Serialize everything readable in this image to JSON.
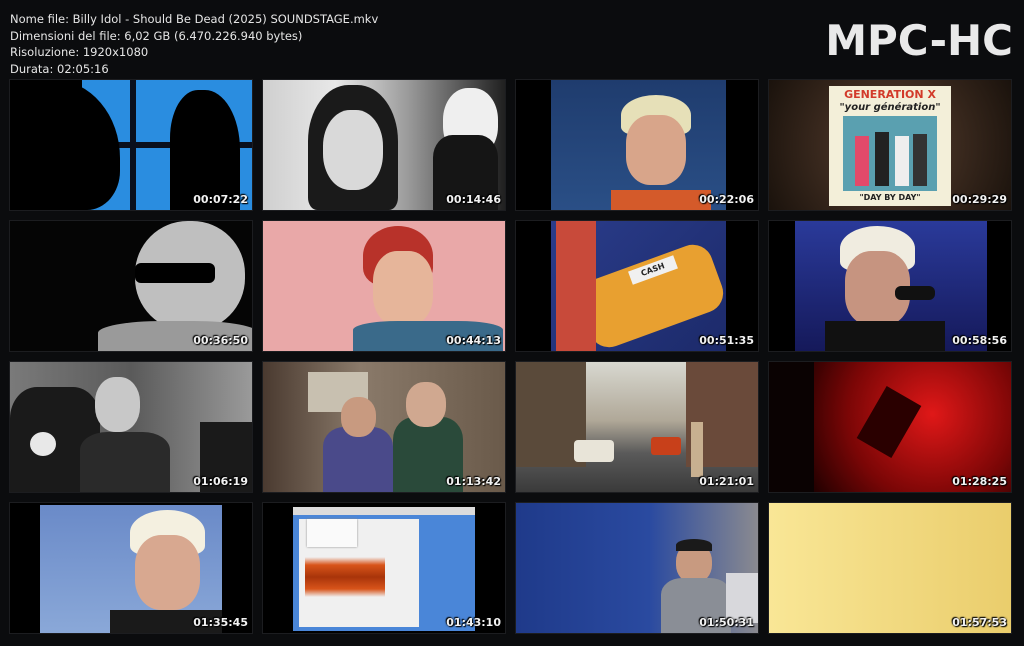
{
  "file_info": [
    "Nome file: Billy Idol - Should Be Dead (2025) SOUNDSTAGE.mkv",
    "Dimensioni del file: 6,02 GB (6.470.226.940 bytes)",
    "Risoluzione: 1920x1080",
    "Durata: 02:05:16"
  ],
  "brand": "MPC-HC",
  "thumbnails": [
    {
      "time": "00:07:22"
    },
    {
      "time": "00:14:46"
    },
    {
      "time": "00:22:06"
    },
    {
      "time": "00:29:29"
    },
    {
      "time": "00:36:50"
    },
    {
      "time": "00:44:13"
    },
    {
      "time": "00:51:35"
    },
    {
      "time": "00:58:56"
    },
    {
      "time": "01:06:19"
    },
    {
      "time": "01:13:42"
    },
    {
      "time": "01:21:01"
    },
    {
      "time": "01:28:25"
    },
    {
      "time": "01:35:45"
    },
    {
      "time": "01:43:10"
    },
    {
      "time": "01:50:31"
    },
    {
      "time": "01:57:53"
    }
  ],
  "record_sleeve": {
    "band": "GENERATION X",
    "title": "\"your génération\"",
    "subtitle": "\"DAY BY DAY\""
  },
  "guitar_text": "CASH",
  "colors": {
    "background": "#0b0c0e",
    "text": "#e6e6e6"
  }
}
